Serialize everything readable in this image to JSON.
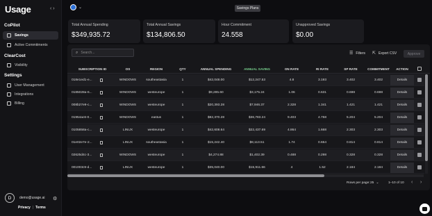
{
  "app": {
    "logo": "Usage",
    "collapse_icon": "‹ ›",
    "page_title": "Savings Plans"
  },
  "sidebar": {
    "copilot_title": "CoPilot",
    "copilot_items": [
      {
        "label": "Savings",
        "icon": "savings-icon",
        "active": true
      },
      {
        "label": "Active Commitments",
        "icon": "commitments-icon",
        "active": false
      }
    ],
    "clearcost_title": "ClearCost",
    "clearcost_items": [
      {
        "label": "Visibility",
        "icon": "visibility-icon",
        "active": false
      }
    ],
    "settings_title": "Settings",
    "settings_items": [
      {
        "label": "User Management",
        "icon": "users-icon"
      },
      {
        "label": "Integrations",
        "icon": "integrations-icon"
      },
      {
        "label": "Billing",
        "icon": "billing-icon"
      }
    ],
    "user": {
      "initial": "D",
      "email": "demo@usage.ai"
    },
    "footer": {
      "privacy": "Privacy",
      "terms": "Terms",
      "sep": "|"
    }
  },
  "stats": [
    {
      "label": "Total Annual Spending",
      "value": "$349,935.72"
    },
    {
      "label": "Total Annual Savings",
      "value": "$134,806.50"
    },
    {
      "label": "Hour Commitment",
      "value": "24.558"
    },
    {
      "label": "Unapproved Savings",
      "value": "$0.00"
    }
  ],
  "toolbar": {
    "search_placeholder": "Search...",
    "filters": "Filters",
    "export": "Export CSV",
    "approve": "Approve"
  },
  "table": {
    "headers": [
      "SUBSCRIPTION ID",
      "OS",
      "REGION",
      "QTY",
      "ANNUAL SPENDING",
      "ANNUAL SAVING",
      "ON RATE",
      "RI RATE",
      "SP RATE",
      "COMMITMENT",
      "ACTION"
    ],
    "details_label": "Details",
    "rows": [
      [
        "018e1ed1-e...",
        "WINDOWS",
        "southeastasia",
        "1",
        "$42,048.00",
        "$12,247.53",
        "4.8",
        "3.193",
        "3.402",
        "3.402"
      ],
      [
        "0185028a-6...",
        "WINDOWS",
        "westeurope",
        "1",
        "$9,285.60",
        "$3,175.24",
        "1.06",
        "0.631",
        "0.698",
        "0.698"
      ],
      [
        "008b27e9-c...",
        "WINDOWS",
        "westeurope",
        "1",
        "$20,393.28",
        "$7,946.37",
        "2.328",
        "1.341",
        "1.421",
        "1.421"
      ],
      [
        "01954ac6-0...",
        "WINDOWS",
        "eastus",
        "1",
        "$82,370.28",
        "$36,783.24",
        "9.403",
        "4.758",
        "5.204",
        "5.204"
      ],
      [
        "0105858a-c...",
        "LINUX",
        "westeurope",
        "1",
        "$42,608.64",
        "$22,437.69",
        "4.864",
        "1.668",
        "2.303",
        "2.303"
      ],
      [
        "01e02e7e-2...",
        "LINUX",
        "southeastasia",
        "1",
        "$15,242.40",
        "$8,113.51",
        "1.74",
        "0.654",
        "0.814",
        "0.814"
      ],
      [
        "02625d4c-3...",
        "WINDOWS",
        "westeurope",
        "1",
        "$4,274.88",
        "$1,402.39",
        "0.488",
        "0.298",
        "0.328",
        "0.328"
      ],
      [
        "001003c9-d...",
        "LINUX",
        "westeurope",
        "1",
        "$35,040.00",
        "$15,911.66",
        "4",
        "1.52",
        "2.184",
        "2.184"
      ]
    ]
  },
  "pagination": {
    "rows_label": "Rows per page:",
    "rows_value": "25",
    "range": "1–10 of 10",
    "prev": "‹",
    "next": "›"
  },
  "colors": {
    "accent": "#79d08e",
    "background": "#0d0d10",
    "panel": "#17171a"
  }
}
